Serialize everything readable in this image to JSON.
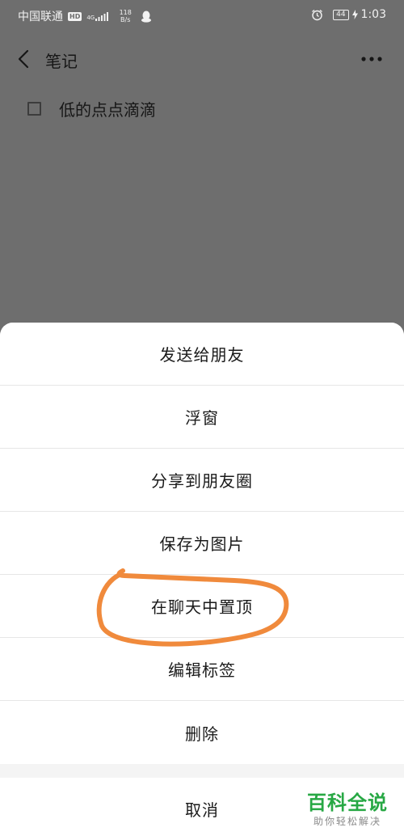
{
  "status_bar": {
    "carrier": "中国联通",
    "hd_badge": "HD",
    "network_type": "4G",
    "network_speed": "118 B/s",
    "battery": "44",
    "time": "1:03"
  },
  "header": {
    "title": "笔记"
  },
  "note": {
    "items": [
      {
        "text": "低的点点滴滴",
        "checked": false
      }
    ]
  },
  "action_sheet": {
    "items": [
      {
        "label": "发送给朋友"
      },
      {
        "label": "浮窗"
      },
      {
        "label": "分享到朋友圈"
      },
      {
        "label": "保存为图片"
      },
      {
        "label": "在聊天中置顶"
      },
      {
        "label": "编辑标签"
      },
      {
        "label": "删除"
      }
    ],
    "cancel_label": "取消"
  },
  "annotation": {
    "color": "#f08a3c",
    "target": "在聊天中置顶"
  },
  "watermark": {
    "main": "百科全说",
    "sub": "助你轻松解决",
    "color": "#27a844"
  }
}
